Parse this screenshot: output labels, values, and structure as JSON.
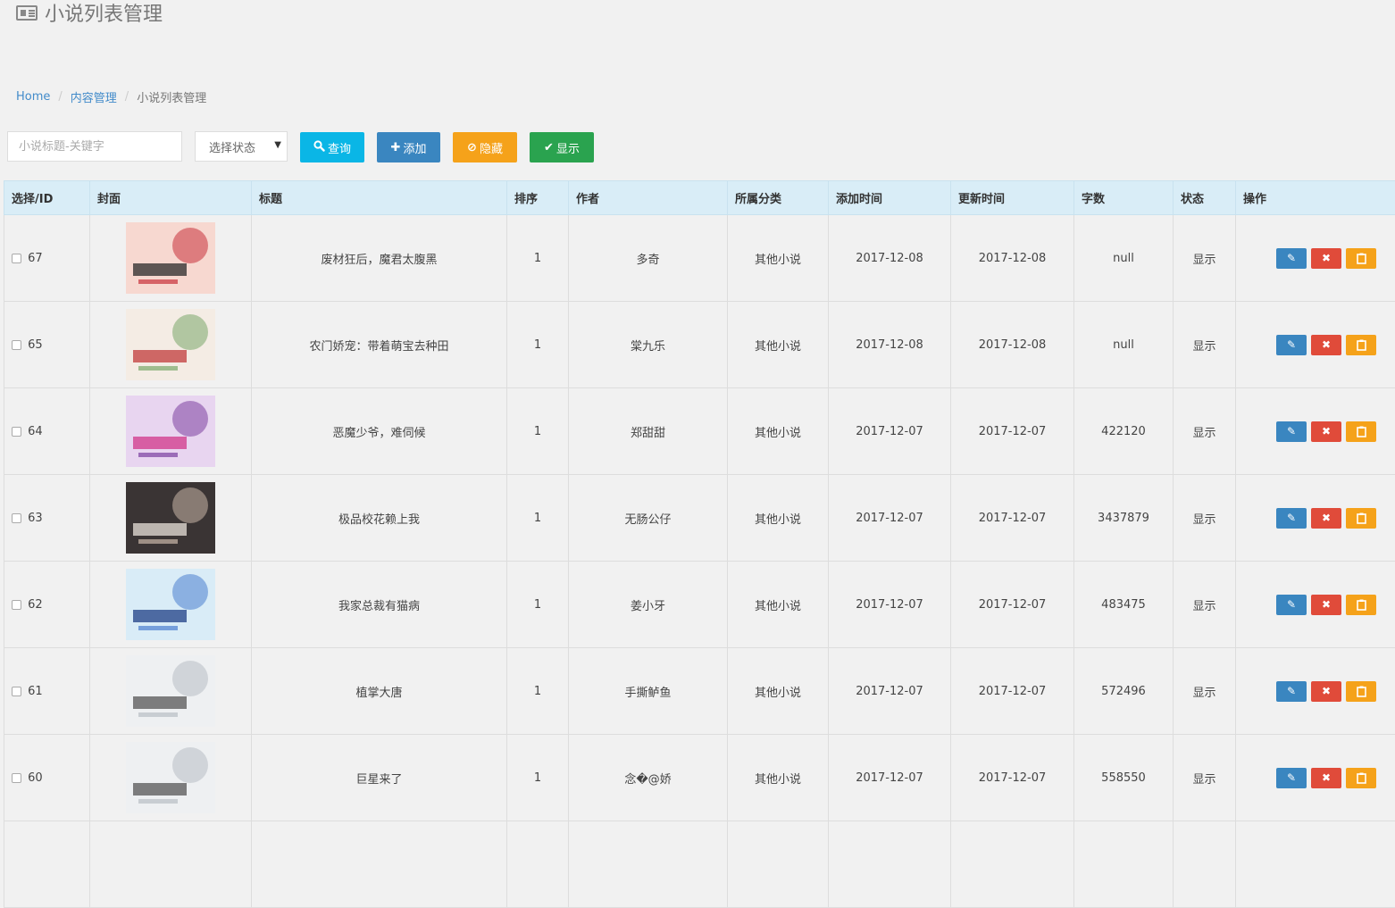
{
  "header": {
    "title": "小说列表管理"
  },
  "breadcrumb": {
    "home": "Home",
    "content": "内容管理",
    "current": "小说列表管理"
  },
  "toolbar": {
    "search_placeholder": "小说标题-关键字",
    "status_select": "选择状态",
    "query_label": "查询",
    "add_label": "添加",
    "hide_label": "隐藏",
    "show_label": "显示"
  },
  "table": {
    "columns": [
      "选择/ID",
      "封面",
      "标题",
      "排序",
      "作者",
      "所属分类",
      "添加时间",
      "更新时间",
      "字数",
      "状态",
      "操作"
    ],
    "rows": [
      {
        "id": "67",
        "title": "废材狂后，魔君太腹黑",
        "sort": "1",
        "author": "多奇",
        "category": "其他小说",
        "added": "2017-12-08",
        "updated": "2017-12-08",
        "words": "null",
        "status": "显示"
      },
      {
        "id": "65",
        "title": "农门娇宠：带着萌宝去种田",
        "sort": "1",
        "author": "棠九乐",
        "category": "其他小说",
        "added": "2017-12-08",
        "updated": "2017-12-08",
        "words": "null",
        "status": "显示"
      },
      {
        "id": "64",
        "title": "恶魔少爷，难伺候",
        "sort": "1",
        "author": "郑甜甜",
        "category": "其他小说",
        "added": "2017-12-07",
        "updated": "2017-12-07",
        "words": "422120",
        "status": "显示"
      },
      {
        "id": "63",
        "title": "极品校花赖上我",
        "sort": "1",
        "author": "无肠公仔",
        "category": "其他小说",
        "added": "2017-12-07",
        "updated": "2017-12-07",
        "words": "3437879",
        "status": "显示"
      },
      {
        "id": "62",
        "title": "我家总裁有猫病",
        "sort": "1",
        "author": "姜小牙",
        "category": "其他小说",
        "added": "2017-12-07",
        "updated": "2017-12-07",
        "words": "483475",
        "status": "显示"
      },
      {
        "id": "61",
        "title": "植掌大唐",
        "sort": "1",
        "author": "手撕鲈鱼",
        "category": "其他小说",
        "added": "2017-12-07",
        "updated": "2017-12-07",
        "words": "572496",
        "status": "显示"
      },
      {
        "id": "60",
        "title": "巨星来了",
        "sort": "1",
        "author": "念�@娇",
        "category": "其他小说",
        "added": "2017-12-07",
        "updated": "2017-12-07",
        "words": "558550",
        "status": "显示"
      }
    ]
  },
  "icons": {
    "query": "search-icon",
    "add": "plus-icon",
    "hide": "ban-icon",
    "show": "check-icon",
    "edit": "pencil-icon",
    "delete": "close-icon",
    "copy": "clipboard-icon"
  },
  "colors": {
    "query": "#0ab6e6",
    "add": "#3a86c0",
    "hide": "#f5a21a",
    "show": "#2aa34f",
    "edit": "#3a86c0",
    "delete": "#e04b3a",
    "copy": "#f5a21a",
    "header_bg": "#d9edf7"
  }
}
